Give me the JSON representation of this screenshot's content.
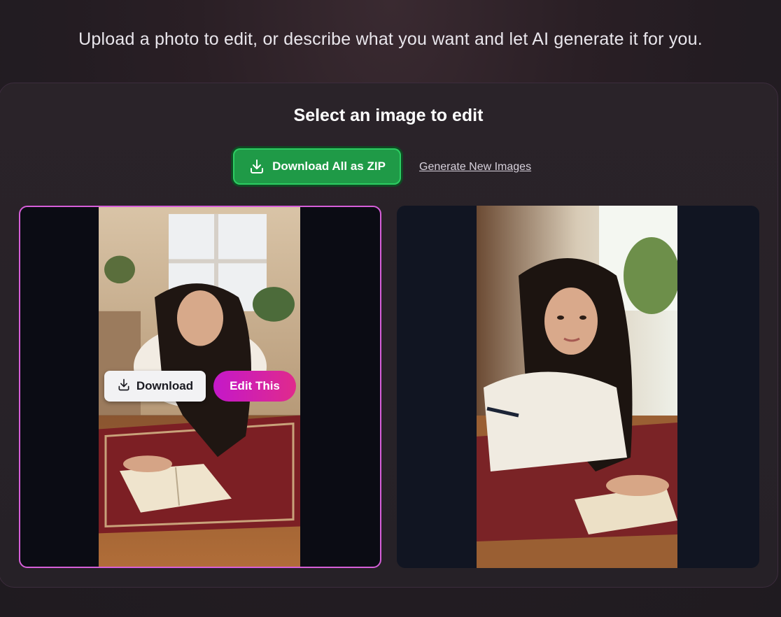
{
  "header": {
    "subtitle": "Upload a photo to edit, or describe what you want and let AI generate it for you."
  },
  "panel": {
    "title": "Select an image to edit",
    "zip_button": "Download All as ZIP",
    "generate_link": "Generate New Images"
  },
  "cards": [
    {
      "selected": true,
      "download_label": "Download",
      "edit_label": "Edit This"
    },
    {
      "selected": false
    }
  ],
  "colors": {
    "accent_green": "#1f9a47",
    "accent_pink": "#d65fd9",
    "edit_gradient_start": "#c418c9",
    "edit_gradient_end": "#e02a8c"
  },
  "icons": {
    "zip_button": "download-icon",
    "overlay_download": "download-icon"
  }
}
